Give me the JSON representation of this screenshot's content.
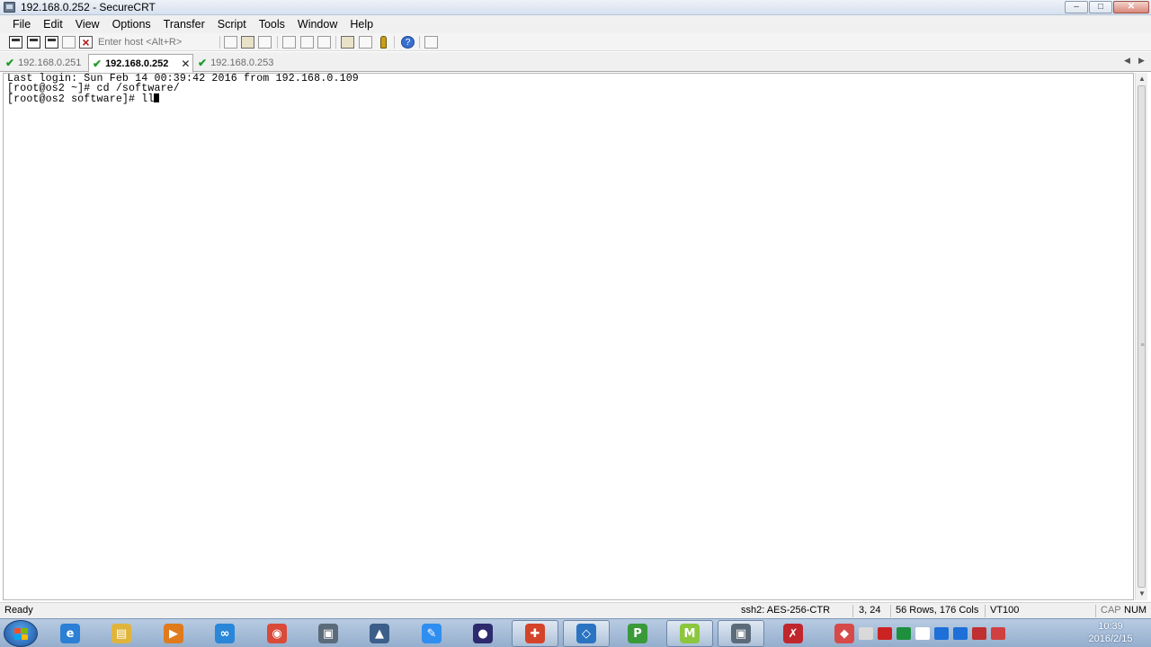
{
  "window": {
    "title": "192.168.0.252 - SecureCRT",
    "controls": {
      "minimize": "–",
      "maximize": "□",
      "close": "✕"
    }
  },
  "menu": [
    "File",
    "Edit",
    "View",
    "Options",
    "Transfer",
    "Script",
    "Tools",
    "Window",
    "Help"
  ],
  "toolbar": {
    "host_placeholder": "Enter host <Alt+R>",
    "icons": [
      "connect-icon",
      "quick-connect-icon",
      "connect-in-tab-icon",
      "reconnect-icon",
      "disconnect-icon",
      "copy-icon",
      "paste-icon",
      "find-icon",
      "print-icon",
      "print-selection-icon",
      "print-setup-icon",
      "session-options-icon",
      "global-options-icon",
      "keymap-icon",
      "help-icon",
      "sftp-icon"
    ]
  },
  "tabs": [
    {
      "label": "192.168.0.251",
      "active": false,
      "status_icon": "check-icon"
    },
    {
      "label": "192.168.0.252",
      "active": true,
      "status_icon": "check-icon",
      "close": "✕"
    },
    {
      "label": "192.168.0.253",
      "active": false,
      "status_icon": "check-icon"
    }
  ],
  "tab_nav": {
    "left": "◀",
    "right": "▶"
  },
  "terminal": {
    "lines": [
      "Last login: Sun Feb 14 00:39:42 2016 from 192.168.0.109",
      "[root@os2 ~]# cd /software/",
      "[root@os2 software]# ll"
    ]
  },
  "statusbar": {
    "state": "Ready",
    "cipher": "ssh2: AES-256-CTR",
    "cursor_pos": "3,  24",
    "size": "56 Rows, 176 Cols",
    "emulation": "VT100",
    "cap": "CAP",
    "num": "NUM"
  },
  "taskbar": {
    "apps": [
      {
        "name": "internet-explorer-icon",
        "glyph": "e",
        "color": "#2b7fd4",
        "running": false
      },
      {
        "name": "file-explorer-icon",
        "glyph": "▤",
        "color": "#e0b43c",
        "running": false
      },
      {
        "name": "media-player-icon",
        "glyph": "▶",
        "color": "#e07a1c",
        "running": false
      },
      {
        "name": "cloud-sync-icon",
        "glyph": "∞",
        "color": "#2a86d8",
        "running": false
      },
      {
        "name": "chrome-icon",
        "glyph": "◉",
        "color": "#d94a38",
        "running": false
      },
      {
        "name": "securecrt-icon",
        "glyph": "▣",
        "color": "#5c6b7a",
        "running": false
      },
      {
        "name": "lock-app-icon",
        "glyph": "▲",
        "color": "#3c5f8a",
        "running": false
      },
      {
        "name": "pen-app-icon",
        "glyph": "✎",
        "color": "#2f8ef0",
        "running": false
      },
      {
        "name": "eclipse-icon",
        "glyph": "●",
        "color": "#2d2a6e",
        "running": false
      },
      {
        "name": "puzzle-app-icon",
        "glyph": "✚",
        "color": "#d4442a",
        "running": true
      },
      {
        "name": "virtualbox-icon",
        "glyph": "◇",
        "color": "#2b74c2",
        "running": true
      },
      {
        "name": "project-app-icon",
        "glyph": "P",
        "color": "#3a9a3a",
        "running": false
      },
      {
        "name": "mindmap-app-icon",
        "glyph": "M",
        "color": "#8cc63e",
        "running": true
      },
      {
        "name": "securecrt-running-icon",
        "glyph": "▣",
        "color": "#5c6b7a",
        "running": true
      },
      {
        "name": "pdf-app-icon",
        "glyph": "✗",
        "color": "#c0272d",
        "running": false
      },
      {
        "name": "eraser-app-icon",
        "glyph": "◆",
        "color": "#d64a4a",
        "running": false
      }
    ],
    "tray_colors": [
      "#d9d9d9",
      "#cc2222",
      "#1e8f3c",
      "#ffffff",
      "#1e6fd8",
      "#1e6fd8",
      "#c03030",
      "#d04040"
    ],
    "time": "10:39",
    "date": "2016/2/15"
  }
}
